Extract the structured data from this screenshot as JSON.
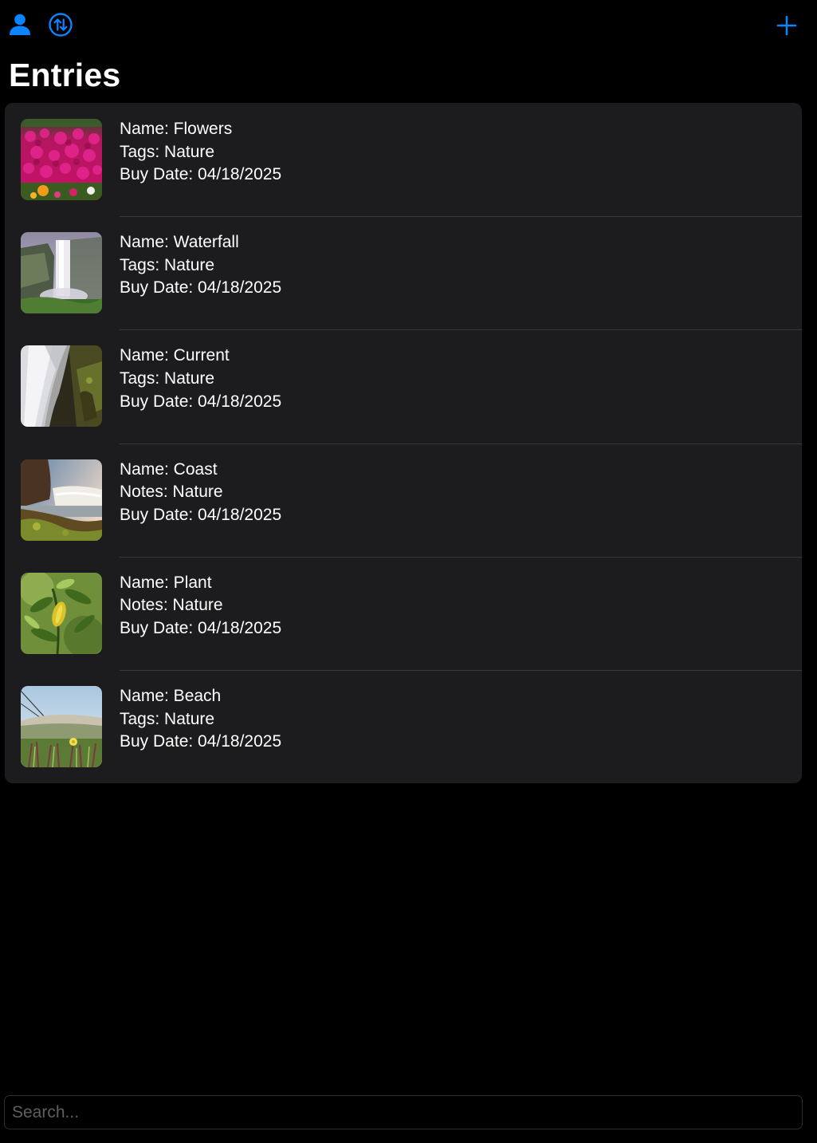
{
  "colors": {
    "accent": "#0a84ff",
    "background": "#000000",
    "card": "#1c1c1e",
    "separator": "#38383a",
    "text": "#ffffff",
    "placeholder": "#5f5f63"
  },
  "toolbar": {
    "left_icons": [
      "person-icon",
      "sort-arrows-icon"
    ],
    "right_icons": [
      "plus-icon"
    ]
  },
  "header": {
    "title": "Entries"
  },
  "entries": [
    {
      "name": "Name: Flowers",
      "tags": "Tags: Nature",
      "date": "Buy Date: 04/18/2025",
      "image": "flowers-photo"
    },
    {
      "name": "Name: Waterfall",
      "tags": "Tags: Nature",
      "date": "Buy Date: 04/18/2025",
      "image": "waterfall-photo"
    },
    {
      "name": "Name: Current",
      "tags": "Tags: Nature",
      "date": "Buy Date: 04/18/2025",
      "image": "current-photo"
    },
    {
      "name": "Name: Coast",
      "tags": "Notes: Nature",
      "date": "Buy Date: 04/18/2025",
      "image": "coast-photo"
    },
    {
      "name": "Name: Plant",
      "tags": "Notes: Nature",
      "date": "Buy Date: 04/18/2025",
      "image": "plant-photo"
    },
    {
      "name": "Name: Beach",
      "tags": "Tags: Nature",
      "date": "Buy Date: 04/18/2025",
      "image": "beach-photo"
    }
  ],
  "search": {
    "placeholder": "Search...",
    "value": ""
  }
}
